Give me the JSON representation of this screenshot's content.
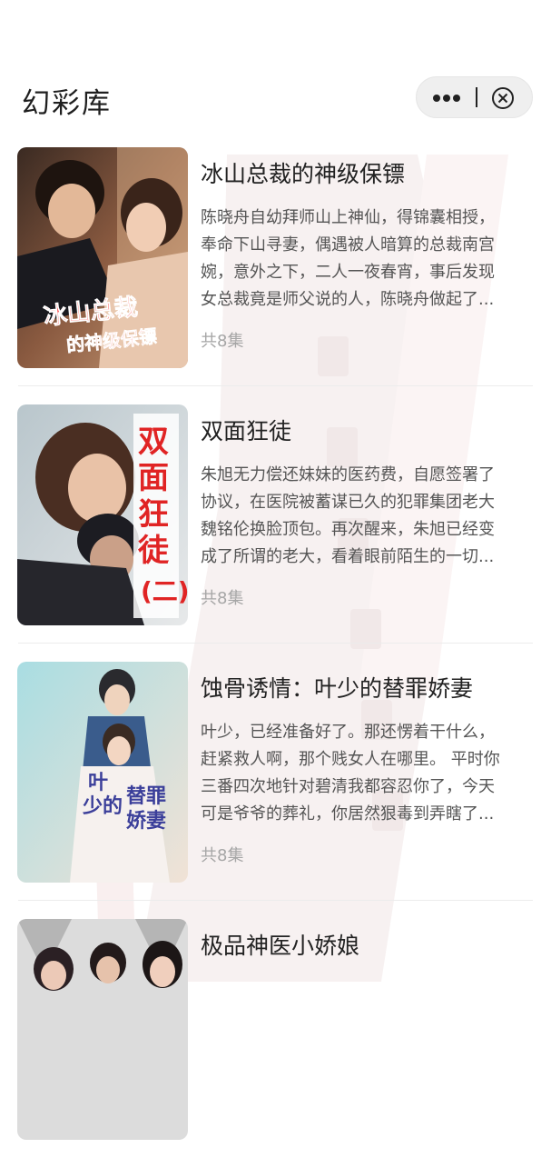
{
  "header": {
    "title": "幻彩库"
  },
  "capsule": {
    "more_icon": "more-dots-icon",
    "close_icon": "close-circle-icon"
  },
  "dramas": [
    {
      "title": "冰山总裁的神级保镖",
      "desc_lines": [
        "陈晓舟自幼拜师山上神仙，得锦囊相授，",
        "奉命下山寻妻，偶遇被人暗算的总裁南宫",
        "婉，意外之下，二人一夜春宵，事后发现",
        "女总裁竟是师父说的人，陈晓舟做起了..."
      ],
      "episodes": "共8集",
      "cover_text": "冰山总裁的神级保镖"
    },
    {
      "title": "双面狂徒",
      "desc_lines": [
        "朱旭无力偿还妹妹的医药费，自愿签署了",
        "协议，在医院被蓄谋已久的犯罪集团老大",
        "魏铭伦换脸顶包。再次醒来，朱旭已经变",
        "成了所谓的老大，看着眼前陌生的一切..."
      ],
      "episodes": "共8集",
      "cover_text": "双面狂徒(二)"
    },
    {
      "title": "蚀骨诱情：叶少的替罪娇妻",
      "desc_lines": [
        "叶少，已经准备好了。那还愣着干什么，",
        "赶紧救人啊，那个贱女人在哪里。 平时你",
        "三番四次地针对碧清我都容忍你了，今天",
        "可是爷爷的葬礼，你居然狠毒到弄瞎了..."
      ],
      "episodes": "共8集",
      "cover_text": "叶少的替罪娇妻"
    },
    {
      "title": "极品神医小娇娘",
      "desc_lines": [],
      "episodes": "",
      "cover_text": ""
    }
  ],
  "colors": {
    "accent_red": "#e02424",
    "muted_text": "#a6a6a6"
  }
}
